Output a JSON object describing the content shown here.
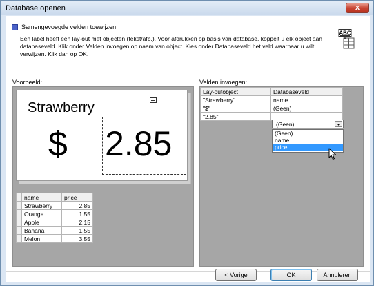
{
  "window": {
    "title": "Database openen",
    "close_label": "x"
  },
  "section": {
    "title": "Samengevoegde velden toewijzen",
    "description": "Een label heeft een lay-out met objecten (tekst/afb.). Voor afdrukken op basis van database, koppelt u elk object aan databaseveld. Klik onder Velden invoegen op naam van object. Kies onder Databaseveld het veld waarnaar u wilt verwijzen. Klik dan op OK.",
    "icon_text": "ABC"
  },
  "preview": {
    "label": "Voorbeeld:",
    "text_object": "Strawberry",
    "currency": "$",
    "price_object": "2.85"
  },
  "database": {
    "headers": [
      "name",
      "price"
    ],
    "rows": [
      [
        "Strawberry",
        "2.85"
      ],
      [
        "Orange",
        "1.55"
      ],
      [
        "Apple",
        "2.15"
      ],
      [
        "Banana",
        "1.55"
      ],
      [
        "Melon",
        "3.55"
      ]
    ]
  },
  "fields": {
    "label": "Velden invoegen:",
    "headers": [
      "Lay-outobject",
      "Databaseveld"
    ],
    "rows": [
      [
        "\"Strawberry\"",
        "name"
      ],
      [
        "\"$\"",
        "(Geen)"
      ],
      [
        "\"2.85\"",
        "(Geen)"
      ]
    ],
    "dropdown_options": [
      "(Geen)",
      "name",
      "price"
    ],
    "dropdown_highlighted": "price"
  },
  "buttons": {
    "prev": "< Vorige",
    "ok": "OK",
    "cancel": "Annuleren"
  },
  "colors": {
    "selection": "#3399ff",
    "accent": "#4b62c8",
    "panel_gray": "#a6a6a6"
  }
}
